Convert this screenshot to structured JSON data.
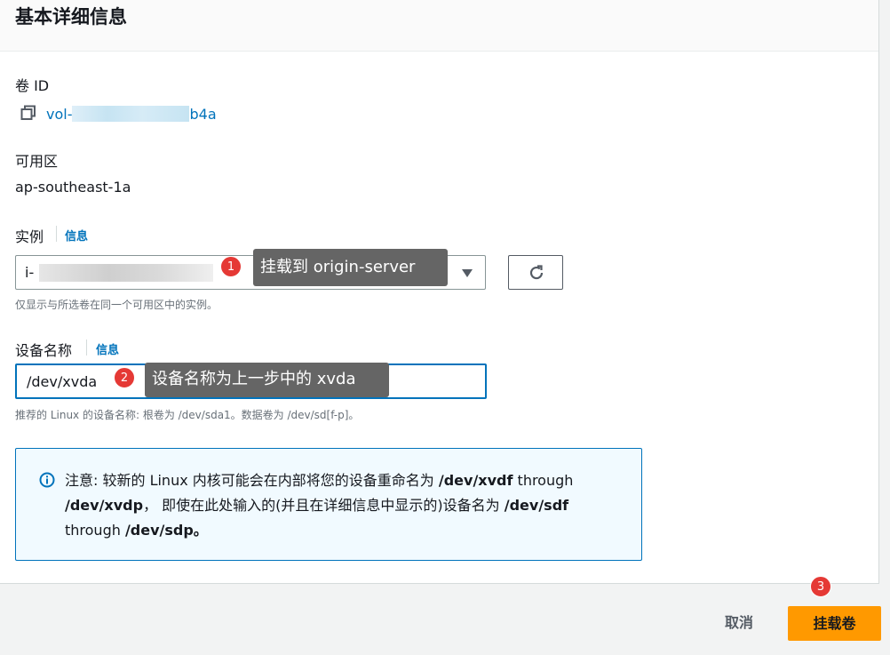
{
  "panel": {
    "title": "基本详细信息"
  },
  "volume": {
    "label": "卷 ID",
    "id_prefix": "vol-",
    "id_suffix": "b4a"
  },
  "availability_zone": {
    "label": "可用区",
    "value": "ap-southeast-1a"
  },
  "instance": {
    "label": "实例",
    "info_link": "信息",
    "selected_prefix": "i-",
    "help_text": "仅显示与所选卷在同一个可用区中的实例。"
  },
  "device": {
    "label": "设备名称",
    "info_link": "信息",
    "value": "/dev/xvda",
    "help_text": "推荐的 Linux 的设备名称: 根卷为 /dev/sda1。数据卷为 /dev/sd[f-p]。"
  },
  "annotations": {
    "step1_number": "1",
    "step1_text": "挂载到  origin-server",
    "step2_number": "2",
    "step2_text": "设备名称为上一步中的 xvda",
    "step3_number": "3"
  },
  "alert": {
    "icon": "info-icon",
    "part1": "注意: 较新的 Linux 内核可能会在内部将您的设备重命名为 ",
    "bold1": "/dev/xvdf",
    "part2": " through ",
    "bold2": "/dev/xvdp",
    "part3": "， 即使在此处输入的(并且在详细信息中显示的)设备名为 ",
    "bold3": "/dev/sdf",
    "part4": " through ",
    "bold4": "/dev/sdp。"
  },
  "footer": {
    "cancel_label": "取消",
    "attach_label": "挂载卷"
  },
  "colors": {
    "accent": "#0073bb",
    "primary_button": "#ff9900",
    "badge": "#e53935",
    "tooltip": "#656565"
  }
}
